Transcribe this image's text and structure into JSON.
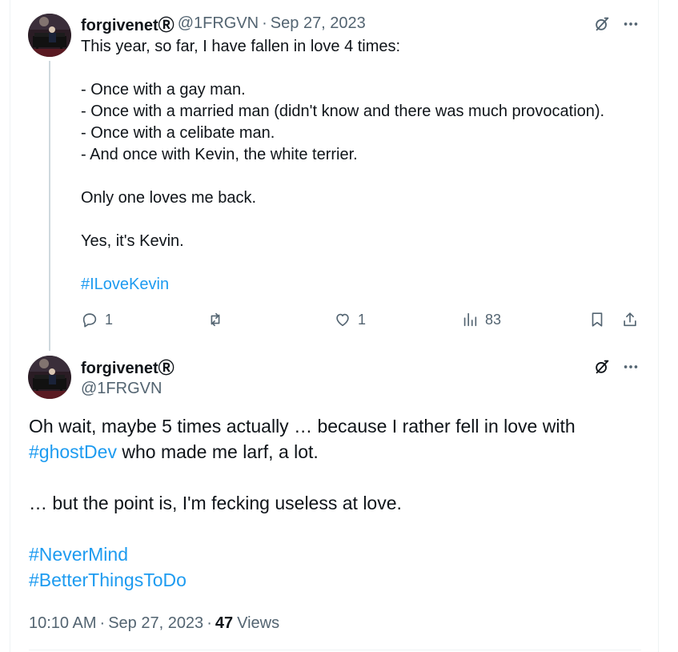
{
  "tweet1": {
    "display_name": "forgivenetⓇ",
    "handle": "@1FRGVN",
    "separator": "·",
    "date": "Sep 27, 2023",
    "lines": [
      "This year, so far, I have fallen in love 4 times:",
      "",
      "- Once with a gay man.",
      "- Once with a married man (didn't know and there was much provocation).",
      "- Once with a celibate man.",
      "- And once with Kevin, the white terrier.",
      "",
      "Only one loves me back.",
      "",
      "Yes, it's Kevin.",
      "",
      "#ILoveKevin"
    ],
    "hashtag": "#ILoveKevin",
    "replies": "1",
    "reposts": "",
    "likes": "1",
    "views": "83"
  },
  "tweet2": {
    "display_name": "forgivenetⓇ",
    "handle": "@1FRGVN",
    "line1": "Oh wait, maybe 5 times actually … because I rather fell in love with",
    "line2_hashtag": "#ghostDev",
    "line2_rest": " who made me larf, a lot.",
    "line3": "… but the point is, I'm fecking useless at love.",
    "hashtag1": "#NeverMind",
    "hashtag2": "#BetterThingsToDo",
    "time": "10:10 AM",
    "separator": "·",
    "date": "Sep 27, 2023",
    "views_count": "47",
    "views_label": "Views"
  },
  "icons": {
    "grok": "grok-icon",
    "more": "more-icon",
    "reply": "reply-icon",
    "repost": "repost-icon",
    "like": "like-icon",
    "views": "views-icon",
    "bookmark": "bookmark-icon",
    "share": "share-icon"
  },
  "colors": {
    "text": "#0f1419",
    "secondary": "#536471",
    "link": "#1d9bf0",
    "thread_line": "#cfd9de"
  }
}
